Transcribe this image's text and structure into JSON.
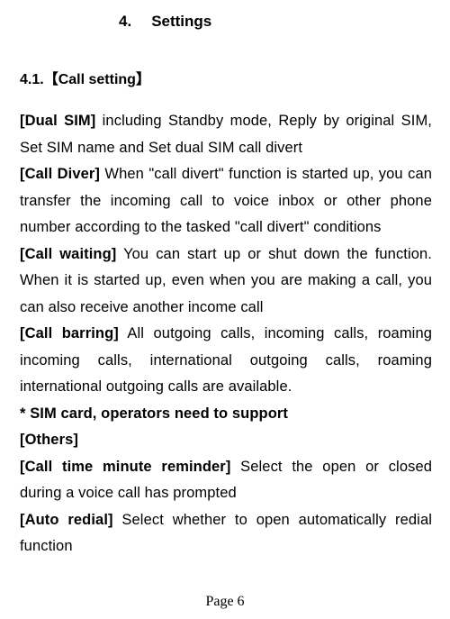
{
  "chapter": {
    "number": "4.",
    "title": "Settings"
  },
  "section": {
    "number": "4.1.",
    "open_bracket": "【",
    "title": "Call setting",
    "close_bracket": "】"
  },
  "items": [
    {
      "label": "[Dual SIM]",
      "text": " including Standby mode, Reply by original SIM, Set SIM name and Set dual SIM call divert"
    },
    {
      "label": "[Call Diver]",
      "text": " When \"call divert\" function is started up, you can transfer the incoming call to voice inbox or other phone number according to the tasked \"call divert\" conditions"
    },
    {
      "label": "[Call waiting]",
      "text": " You can start up or shut down the function. When it is started up, even when you are making a call, you can also receive another income call"
    },
    {
      "label": "[Call barring]",
      "text": " All outgoing calls, incoming calls, roaming incoming calls, international outgoing calls, roaming international outgoing calls are available."
    }
  ],
  "support_note": "* SIM card, operators need to support",
  "others_label": "[Others]",
  "others_items": [
    {
      "label": "[Call time minute reminder]",
      "text": " Select the open or closed during a voice call has prompted"
    },
    {
      "label": "[Auto redial]",
      "text": " Select whether to open automatically redial function"
    }
  ],
  "page_footer": "Page 6"
}
